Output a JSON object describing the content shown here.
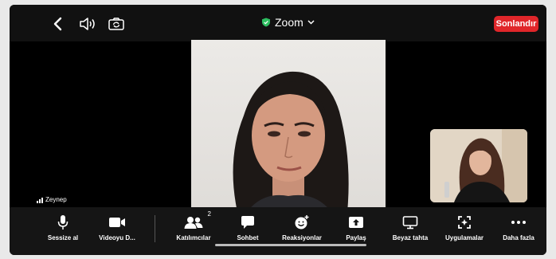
{
  "header": {
    "title": "Zoom",
    "end_label": "Sonlandır"
  },
  "participant": {
    "name": "Zeynep"
  },
  "toolbar": {
    "items": [
      {
        "label": "Sessize al"
      },
      {
        "label": "Videoyu D..."
      },
      {
        "label": "Katılımcılar",
        "badge": "2"
      },
      {
        "label": "Sohbet"
      },
      {
        "label": "Reaksiyonlar"
      },
      {
        "label": "Paylaş"
      },
      {
        "label": "Beyaz tahta"
      },
      {
        "label": "Uygulamalar"
      },
      {
        "label": "Daha fazla"
      }
    ]
  },
  "colors": {
    "end_button": "#e0262a",
    "secure_shield": "#2dbe60"
  }
}
